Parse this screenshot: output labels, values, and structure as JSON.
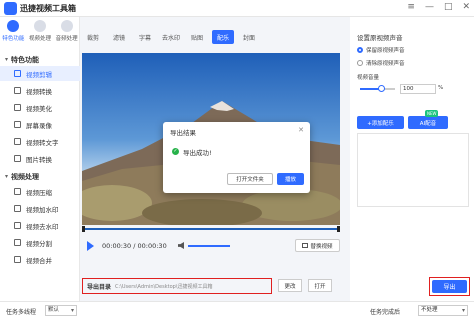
{
  "app": {
    "title": "迅捷视频工具箱"
  },
  "window": {
    "menu": "≡",
    "minimize": "—",
    "maximize": "□",
    "close": "✕"
  },
  "sidebar": {
    "top_tabs": [
      {
        "label": "特色功能"
      },
      {
        "label": "视频处理"
      },
      {
        "label": "音频处理"
      }
    ],
    "sections": [
      {
        "label": "特色功能"
      },
      {
        "label": "视频处理"
      }
    ],
    "items": [
      {
        "label": "视频剪辑"
      },
      {
        "label": "视频转换"
      },
      {
        "label": "视频美化"
      },
      {
        "label": "屏幕录像"
      },
      {
        "label": "视频转文字"
      },
      {
        "label": "图片转换"
      },
      {
        "label": "视频压缩"
      },
      {
        "label": "视频加水印"
      },
      {
        "label": "视频去水印"
      },
      {
        "label": "视频分割"
      },
      {
        "label": "视频合并"
      }
    ]
  },
  "edit_tabs": [
    {
      "label": "裁剪"
    },
    {
      "label": "滤镜"
    },
    {
      "label": "字幕"
    },
    {
      "label": "去水印"
    },
    {
      "label": "贴图"
    },
    {
      "label": "配乐"
    },
    {
      "label": "封面"
    }
  ],
  "modal": {
    "title": "导出结果",
    "close": "✕",
    "check": "✓",
    "message": "导出成功!",
    "open_folder_label": "打开文件夹",
    "play_label": "播放"
  },
  "player": {
    "time": "00:00:30 / 00:00:30",
    "replace_label": "替换视频"
  },
  "right_panel": {
    "title": "设置原视频声音",
    "options": [
      {
        "label": "保留原视频声音",
        "checked": true
      },
      {
        "label": "清除原视频声音",
        "checked": false
      }
    ],
    "volume_label": "视频音量",
    "volume_value": "100",
    "volume_unit": "%",
    "volume_level": 0.6,
    "add_music_label": "+添加配乐",
    "ai_music_label": "AI配音",
    "new_badge": "NEW"
  },
  "export": {
    "label": "导出目录",
    "path": "C:\\Users\\Admin\\Desktop\\迅捷视频工具箱",
    "change_label": "更改",
    "open_label": "打开",
    "export_label": "导出"
  },
  "statusbar": {
    "threads_label": "任务多线程",
    "threads_value": "默认",
    "done_label": "任务完成后",
    "done_value": "不处理"
  },
  "colors": {
    "accent": "#2f6bff",
    "highlight": "#e02020"
  }
}
